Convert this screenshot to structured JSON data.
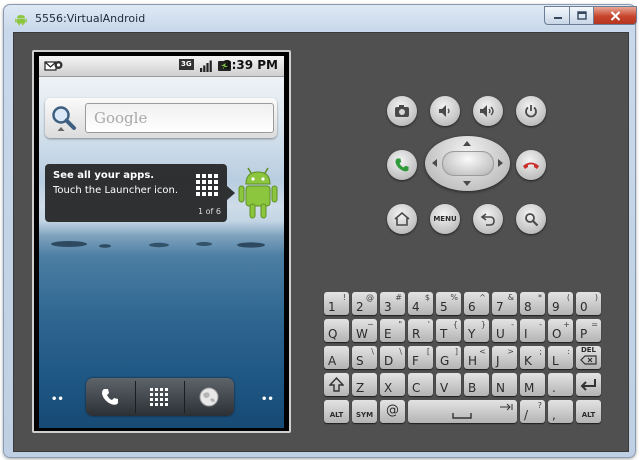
{
  "window": {
    "title": "5556:VirtualAndroid"
  },
  "status_bar": {
    "time": "3:39 PM",
    "network": "3G"
  },
  "search_widget": {
    "placeholder": "Google"
  },
  "launcher_tip": {
    "title": "See all your apps.",
    "body": "Touch the Launcher icon.",
    "page": "1 of 6"
  },
  "home_dots": {
    "left": "••",
    "right": "••"
  },
  "controls": {
    "menu_label": "MENU"
  },
  "keyboard": {
    "rows": [
      [
        {
          "main": "1",
          "alt": "!"
        },
        {
          "main": "2",
          "alt": "@"
        },
        {
          "main": "3",
          "alt": "#"
        },
        {
          "main": "4",
          "alt": "$"
        },
        {
          "main": "5",
          "alt": "%"
        },
        {
          "main": "6",
          "alt": "^"
        },
        {
          "main": "7",
          "alt": "&"
        },
        {
          "main": "8",
          "alt": "*"
        },
        {
          "main": "9",
          "alt": "("
        },
        {
          "main": "0",
          "alt": ")"
        }
      ],
      [
        {
          "main": "Q",
          "alt": ""
        },
        {
          "main": "W",
          "alt": "~"
        },
        {
          "main": "E",
          "alt": "\""
        },
        {
          "main": "R",
          "alt": "'"
        },
        {
          "main": "T",
          "alt": "{"
        },
        {
          "main": "Y",
          "alt": "}"
        },
        {
          "main": "U",
          "alt": "-"
        },
        {
          "main": "I",
          "alt": "-"
        },
        {
          "main": "O",
          "alt": "+"
        },
        {
          "main": "P",
          "alt": "="
        }
      ],
      [
        {
          "main": "A",
          "alt": ""
        },
        {
          "main": "S",
          "alt": "\\"
        },
        {
          "main": "D",
          "alt": "\\"
        },
        {
          "main": "F",
          "alt": "["
        },
        {
          "main": "G",
          "alt": "]"
        },
        {
          "main": "H",
          "alt": "<"
        },
        {
          "main": "J",
          "alt": ">"
        },
        {
          "main": "K",
          "alt": ";"
        },
        {
          "main": "L",
          "alt": ":"
        }
      ],
      [
        {
          "main": "Z",
          "alt": ""
        },
        {
          "main": "X",
          "alt": ""
        },
        {
          "main": "C",
          "alt": ""
        },
        {
          "main": "V",
          "alt": ""
        },
        {
          "main": "B",
          "alt": ""
        },
        {
          "main": "N",
          "alt": ""
        },
        {
          "main": "M",
          "alt": ""
        },
        {
          "main": ".",
          "alt": ""
        }
      ]
    ],
    "del_label": "DEL",
    "alt_label": "ALT",
    "sym_label": "SYM",
    "at_label": "@",
    "slash_label": "/",
    "question_label": "?",
    "comma_label": ","
  }
}
